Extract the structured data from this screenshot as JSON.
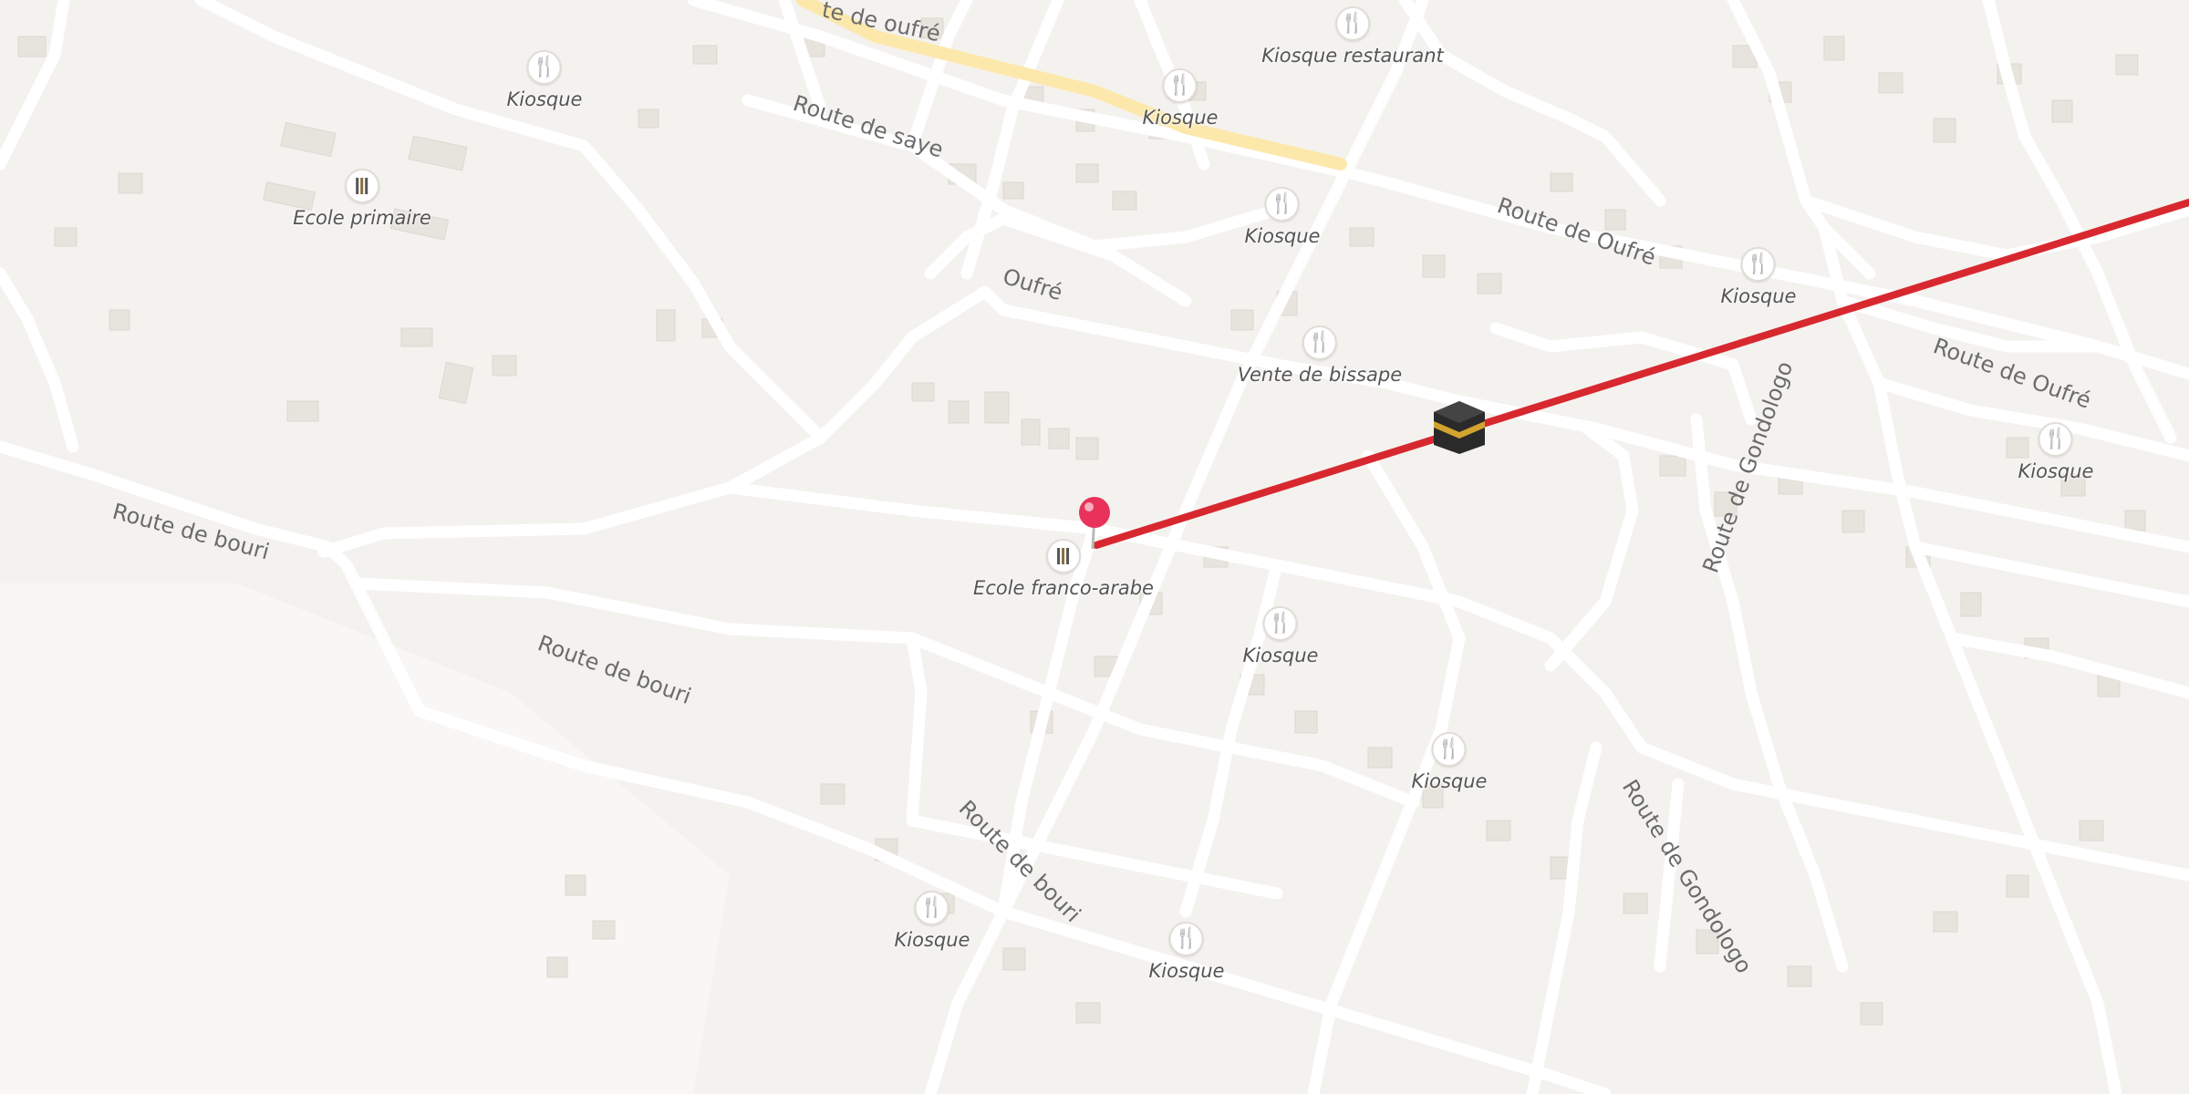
{
  "map": {
    "colors": {
      "background": "#f4f2ef",
      "road": "#ffffff",
      "primary_road": "#fde8ac",
      "building": "#e6e2dc",
      "route_line": "#d8282f",
      "pin": "#e8325a",
      "poi_food": "#d07b11",
      "poi_school": "#555555"
    },
    "road_labels": [
      "te de oufré",
      "Route de saye",
      "Oufré",
      "Route de Oufré",
      "Route de Oufré",
      "Route de Gondologo",
      "Route de Gondologo",
      "Route de bouri",
      "Route de bouri",
      "Route de bouri"
    ],
    "pois": [
      {
        "label": "Kiosque",
        "icon": "fork-knife-icon"
      },
      {
        "label": "Kiosque",
        "icon": "fork-knife-icon"
      },
      {
        "label": "Kiosque restaurant",
        "icon": "fork-knife-icon"
      },
      {
        "label": "Kiosque",
        "icon": "fork-knife-icon"
      },
      {
        "label": "Kiosque",
        "icon": "fork-knife-icon"
      },
      {
        "label": "Vente de bissape",
        "icon": "fork-knife-icon"
      },
      {
        "label": "Kiosque",
        "icon": "fork-knife-icon"
      },
      {
        "label": "Kiosque",
        "icon": "fork-knife-icon"
      },
      {
        "label": "Kiosque",
        "icon": "fork-knife-icon"
      },
      {
        "label": "Kiosque",
        "icon": "fork-knife-icon"
      },
      {
        "label": "Kiosque",
        "icon": "fork-knife-icon"
      },
      {
        "label": "Ecole primaire",
        "icon": "school-icon"
      },
      {
        "label": "Ecole franco-arabe",
        "icon": "school-icon"
      }
    ],
    "markers": {
      "pin_icon": "location-pin-icon",
      "kaaba_icon": "kaaba-icon",
      "route_line": "qibla-direction-line"
    }
  }
}
